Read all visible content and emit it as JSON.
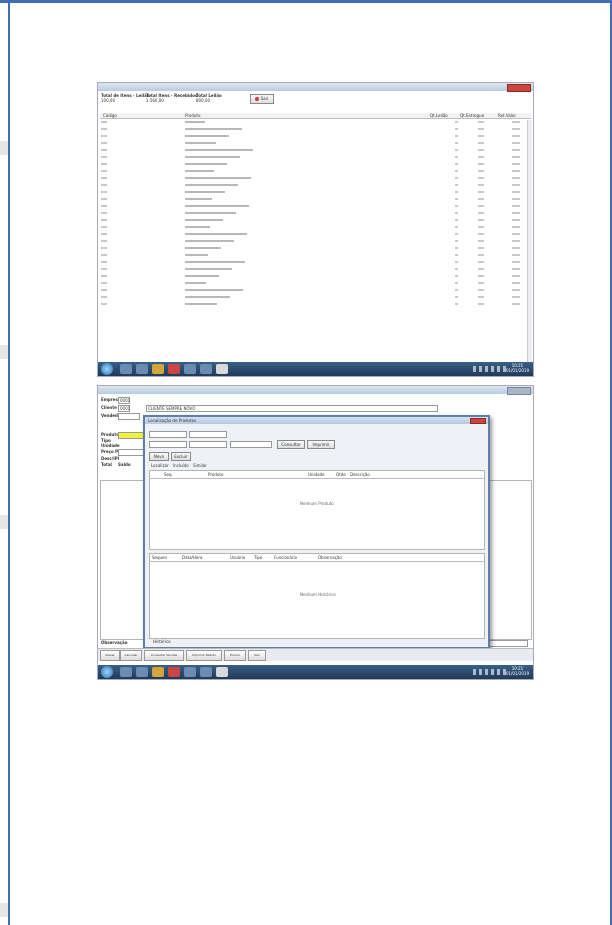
{
  "shot1": {
    "header": {
      "col1_label": "Total de Itens - Leilão",
      "col1_value": "100,00",
      "col2_label": "Total Itens - Recebidos",
      "col2_value": "2.560,00",
      "col3_label": "Total Leilão",
      "col3_value": "800,00",
      "exit_button": "Sair"
    },
    "table": {
      "columns": [
        "Código",
        "Produto",
        "Qt.Leilão",
        "Qt.Entregue",
        "Ret.Valor"
      ]
    },
    "row_count": 27,
    "clock": {
      "time": "10:21",
      "date": "01/01/2019"
    }
  },
  "shot2": {
    "form": {
      "empresa_label": "Empresa",
      "empresa_value": "0001",
      "cliente_label": "Cliente",
      "cliente_value": "0001",
      "cliente_name": "CLIENTE SEMPRE NOVO",
      "vendedor_label": "Vendedor",
      "produto_label": "Produto",
      "tipo_label": "Tipo",
      "unidade_label": "Unidade",
      "preco_label": "Preço Prod.",
      "desconto_label": "Desc/IPI",
      "total_label": "Total",
      "saldo_label": "Saldo",
      "observacao_label": "Observação"
    },
    "dialog": {
      "title": "Localização de Produtos",
      "tab_label": "Produtos",
      "tabs": [
        "Localizar",
        "Incluído",
        "Similar"
      ],
      "btn_new": "Novo",
      "btn_delete": "Excluir",
      "btn_search": "Consultar",
      "btn_close": "Imprimir",
      "upper_columns": [
        "Seq",
        "Produto",
        "Unidade",
        "Qtde",
        "Descrição"
      ],
      "upper_empty": "Nenhum Produto",
      "lower_columns": [
        "Sequen",
        "Data/Hora",
        "Usuário",
        "Tipo",
        "Funcionário",
        "Observação"
      ],
      "lower_empty": "Nenhum Histórico",
      "footer_tab": "Histórico"
    },
    "footer_buttons": [
      "Salvar",
      "Cancelar",
      "Consultar Vendas",
      "Imprimir Pedido",
      "Excluir",
      "Sair"
    ],
    "clock": {
      "time": "10:21",
      "date": "01/01/2019"
    }
  }
}
